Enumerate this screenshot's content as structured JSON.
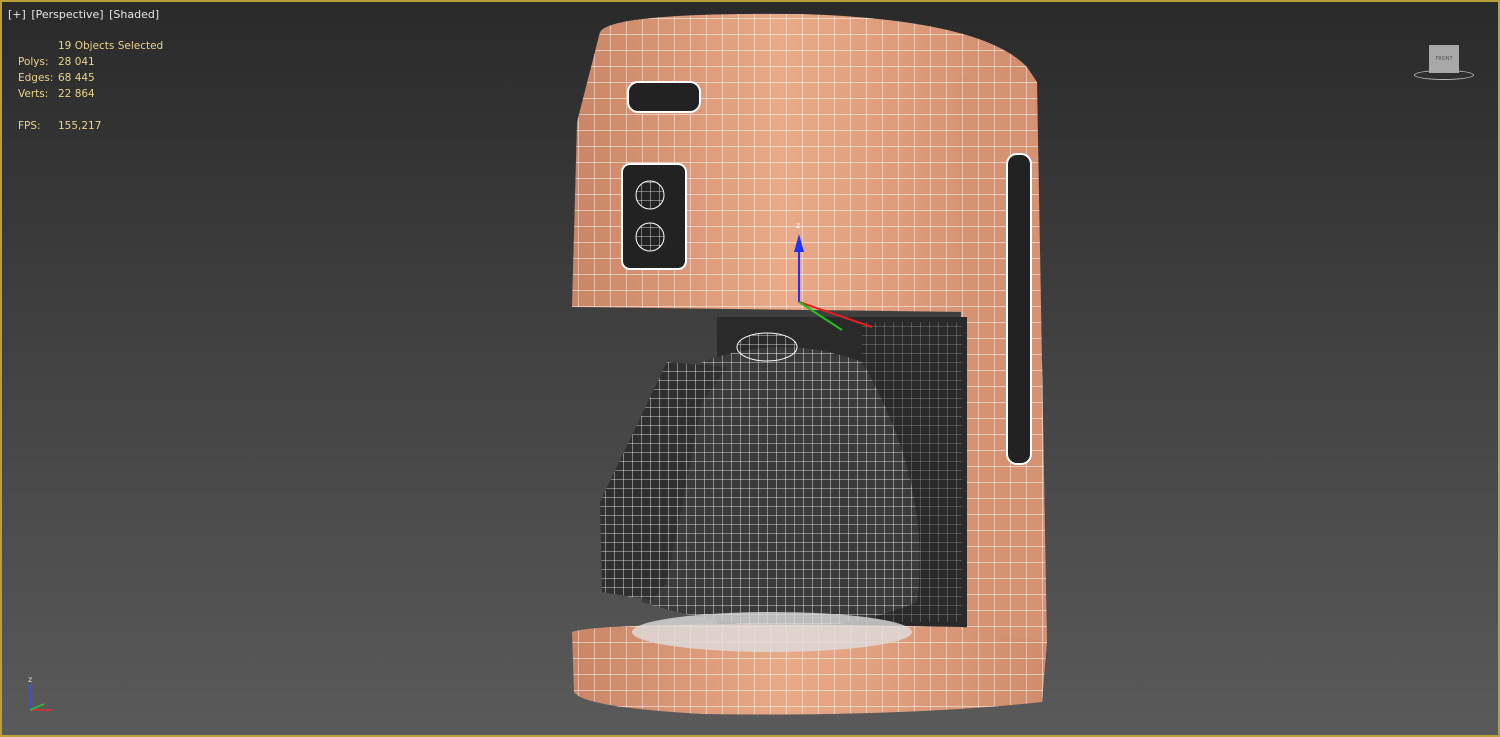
{
  "viewport": {
    "label": {
      "plus": "[+]",
      "view": "[Perspective]",
      "shading": "[Shaded]"
    },
    "stats": {
      "selection": "19 Objects Selected",
      "rows": [
        {
          "key": "Polys:",
          "value": "28 041"
        },
        {
          "key": "Edges:",
          "value": "68 445"
        },
        {
          "key": "Verts:",
          "value": "22 864"
        }
      ],
      "fps_key": "FPS:",
      "fps_value": "155,217"
    },
    "viewcube": {
      "face": "FRONT"
    },
    "axis": {
      "z": "z"
    }
  },
  "colors": {
    "border": "#b9a13a",
    "body": "#e0a080",
    "wire": "#ffffff"
  }
}
